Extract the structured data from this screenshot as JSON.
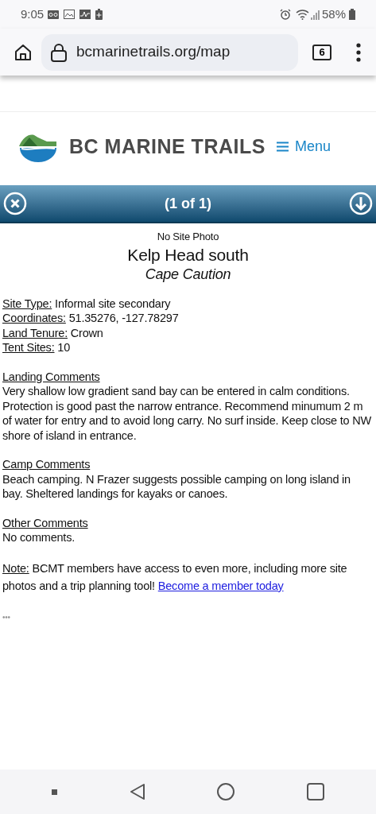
{
  "status_bar": {
    "time": "9:05",
    "battery": "58%"
  },
  "browser": {
    "url": "bcmarinetrails.org/map",
    "tab_count": "6"
  },
  "header": {
    "brand": "BC MARINE TRAILS",
    "menu": "Menu"
  },
  "popup_bar": {
    "pager": "(1 of 1)"
  },
  "site": {
    "photo_note": "No Site Photo",
    "name": "Kelp Head south",
    "region": "Cape Caution",
    "fields": [
      {
        "label": "Site Type:",
        "value": "Informal site secondary"
      },
      {
        "label": "Coordinates:",
        "value": "51.35276, -127.78297"
      },
      {
        "label": "Land Tenure:",
        "value": "Crown"
      },
      {
        "label": "Tent Sites:",
        "value": "10"
      }
    ],
    "sections": [
      {
        "heading": "Landing Comments",
        "text": "Very shallow low gradient sand bay can be entered in calm conditions. Protection is good past the narrow entrance. Recommend minumum 2 m of water for entry and to avoid long carry. No surf inside. Keep close to NW shore of island in entrance."
      },
      {
        "heading": "Camp Comments",
        "text": "Beach camping. N Frazer suggests possible camping on long island in bay. Sheltered landings for kayaks or canoes."
      },
      {
        "heading": "Other Comments",
        "text": "No comments."
      }
    ],
    "note": {
      "label": "Note:",
      "text": "BCMT members have access to even more, including more site photos and a trip planning tool!",
      "link": "Become a member today"
    },
    "more": "•••"
  }
}
